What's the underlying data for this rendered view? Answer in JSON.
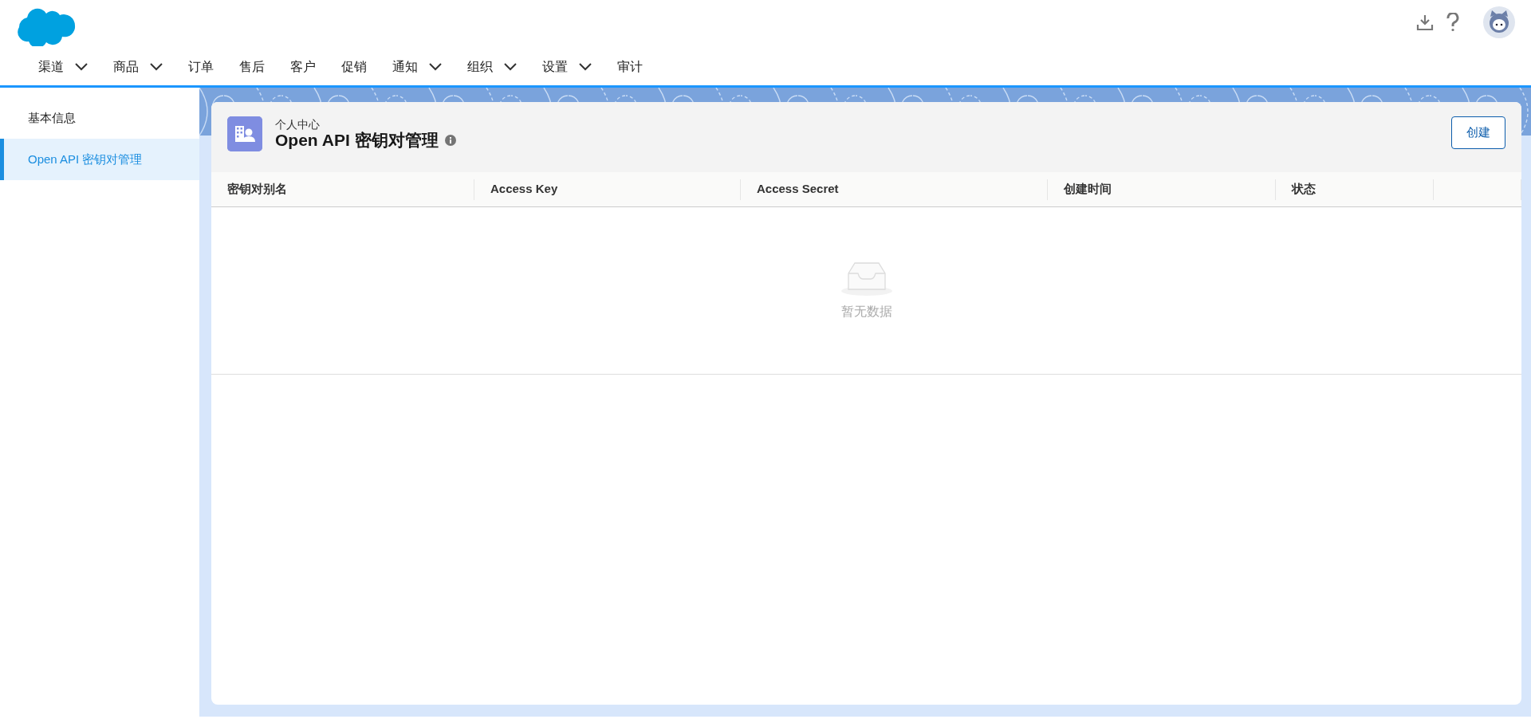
{
  "nav": [
    {
      "label": "渠道",
      "dropdown": true
    },
    {
      "label": "商品",
      "dropdown": true
    },
    {
      "label": "订单",
      "dropdown": false
    },
    {
      "label": "售后",
      "dropdown": false
    },
    {
      "label": "客户",
      "dropdown": false
    },
    {
      "label": "促销",
      "dropdown": false
    },
    {
      "label": "通知",
      "dropdown": true
    },
    {
      "label": "组织",
      "dropdown": true
    },
    {
      "label": "设置",
      "dropdown": true
    },
    {
      "label": "审计",
      "dropdown": false
    }
  ],
  "sidebar": {
    "items": [
      {
        "label": "基本信息",
        "selected": false
      },
      {
        "label": "Open API 密钥对管理",
        "selected": true
      }
    ]
  },
  "page_header": {
    "breadcrumb": "个人中心",
    "title": "Open API 密钥对管理",
    "button": "创建"
  },
  "table": {
    "columns": [
      "密钥对别名",
      "Access Key",
      "Access Secret",
      "创建时间",
      "状态"
    ],
    "empty_text": "暂无数据"
  }
}
